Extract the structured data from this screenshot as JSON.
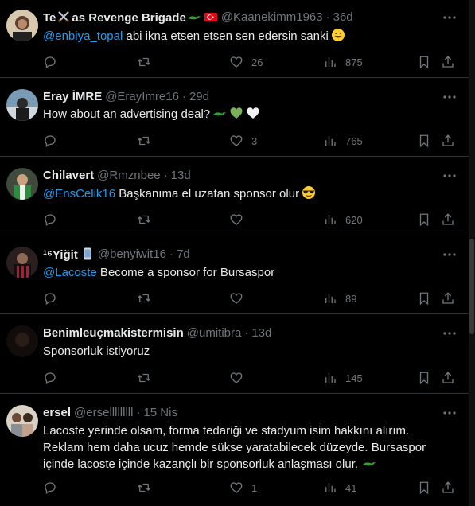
{
  "tweets": [
    {
      "name_prefix": "Te",
      "name_suffix": "as Revenge Brigade",
      "handle": "@Kaanekimm1963",
      "time": "36d",
      "mention": "@enbiya_topal",
      "text": " abi ikna etsen etsen sen edersin sanki",
      "likes": "26",
      "views": "875"
    },
    {
      "name": "Eray İMRE",
      "handle": "@ErayImre16",
      "time": "29d",
      "text": "How about an advertising deal?",
      "likes": "3",
      "views": "765"
    },
    {
      "name": "Chilavert",
      "handle": "@Rmznbee",
      "time": "13d",
      "mention": "@EnsCelik16",
      "text": " Başkanıma el uzatan sponsor olur",
      "views": "620"
    },
    {
      "name": "¹⁶Yiğit",
      "handle": "@benyiwit16",
      "time": "7d",
      "mention": "@Lacoste",
      "text": " Become a sponsor for Bursaspor",
      "views": "89"
    },
    {
      "name": "Benimleuçmakistermisin",
      "handle": "@umitibra",
      "time": "13d",
      "text": "Sponsorluk istiyoruz",
      "views": "145"
    },
    {
      "name": "ersel",
      "handle": "@erselllllllll",
      "time": "15 Nis",
      "lines": [
        "Lacoste yerinde olsam, forma tedariği ve stadyum isim hakkını alırım.",
        "Reklam hem daha ucuz hemde sükse yaratabilecek düzeyde. Bursaspor",
        "içinde lacoste içinde kazançlı bir sponsorluk anlaşması olur."
      ],
      "likes": "1",
      "views": "41"
    }
  ],
  "separator": "·",
  "colors": {
    "accent": "#1d9bf0",
    "muted": "#71767b",
    "text": "#e7e9ea",
    "background": "#000000",
    "border": "#2f3336"
  },
  "icons": [
    "reply-icon",
    "retweet-icon",
    "like-icon",
    "views-icon",
    "bookmark-icon",
    "share-icon",
    "more-icon",
    "crocodile-emoji",
    "swords-emoji",
    "turkey-flag-emoji",
    "green-heart-emoji",
    "white-heart-emoji",
    "smile-emoji",
    "sunglasses-emoji",
    "phone-emoji"
  ]
}
